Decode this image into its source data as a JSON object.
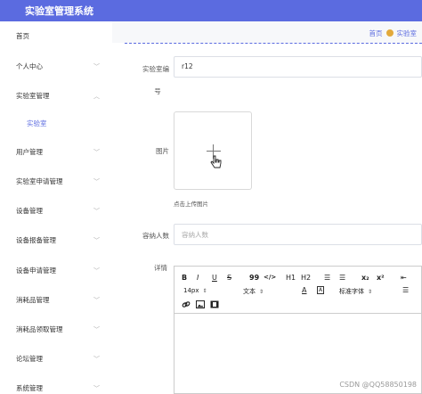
{
  "app": {
    "title": "实验室管理系统"
  },
  "sidebar": {
    "items": [
      {
        "label": "首页",
        "chevron": ""
      },
      {
        "label": "个人中心",
        "chevron": "﹀"
      },
      {
        "label": "实验室管理",
        "chevron": "︿"
      },
      {
        "label": "实验室",
        "chevron": ""
      },
      {
        "label": "用户管理",
        "chevron": "﹀"
      },
      {
        "label": "实验室申请管理",
        "chevron": "﹀"
      },
      {
        "label": "设备管理",
        "chevron": "﹀"
      },
      {
        "label": "设备报备管理",
        "chevron": "﹀"
      },
      {
        "label": "设备申请管理",
        "chevron": "﹀"
      },
      {
        "label": "消耗品管理",
        "chevron": "﹀"
      },
      {
        "label": "消耗品领取管理",
        "chevron": "﹀"
      },
      {
        "label": "论坛管理",
        "chevron": "﹀"
      },
      {
        "label": "系统管理",
        "chevron": "﹀"
      }
    ]
  },
  "breadcrumb": {
    "home": "首页",
    "current": "实验室"
  },
  "form": {
    "lab_number_label_line1": "实验室编",
    "lab_number_label_line2": "号",
    "lab_number_value": "r12",
    "image_label": "图片",
    "upload_hint": "点击上传图片",
    "capacity_label": "容纳人数",
    "capacity_placeholder": "容纳人数",
    "details_label": "详情"
  },
  "editor": {
    "row1": [
      "B",
      "I",
      "U",
      "S",
      "99",
      "</>",
      "H1",
      "H2",
      "☰",
      "☰",
      "x₂",
      "x²",
      "⇤"
    ],
    "font_size": "14px",
    "text_style": "文本",
    "font_family": "标准字体",
    "color_icons": [
      "A",
      "A"
    ]
  },
  "watermark": "CSDN @QQ58850198",
  "colors": {
    "accent": "#5b6be0"
  }
}
